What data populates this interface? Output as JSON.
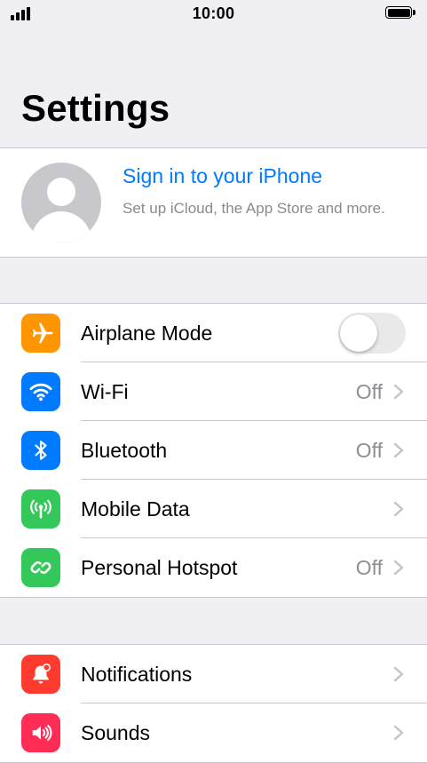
{
  "status_bar": {
    "time": "10:00",
    "signal_bars": 4,
    "battery_level_percent": 100
  },
  "page": {
    "title": "Settings"
  },
  "profile": {
    "name": "Sign in to your iPhone",
    "subtitle": "Set up iCloud, the App Store and more."
  },
  "group1": {
    "rows": [
      {
        "label": "Airplane Mode",
        "icon": "airplane-icon",
        "color": "#ff9500",
        "toggle_on": false
      },
      {
        "label": "Wi-Fi",
        "icon": "wifi-icon",
        "color": "#007aff",
        "value": "Off"
      },
      {
        "label": "Bluetooth",
        "icon": "bluetooth-icon",
        "color": "#007aff",
        "value": "Off"
      },
      {
        "label": "Mobile Data",
        "icon": "antenna-icon",
        "color": "#34c759"
      },
      {
        "label": "Personal Hotspot",
        "icon": "hotspot-icon",
        "color": "#34c759",
        "value": "Off"
      }
    ]
  },
  "group2": {
    "rows": [
      {
        "label": "Notifications",
        "icon": "bell-icon",
        "color": "#ff3b30"
      },
      {
        "label": "Sounds",
        "icon": "speaker-icon",
        "color": "#ff2d55"
      }
    ]
  },
  "colors": {
    "accent": "#007aff",
    "background": "#efeff4",
    "secondary_text": "#8e8e93"
  }
}
